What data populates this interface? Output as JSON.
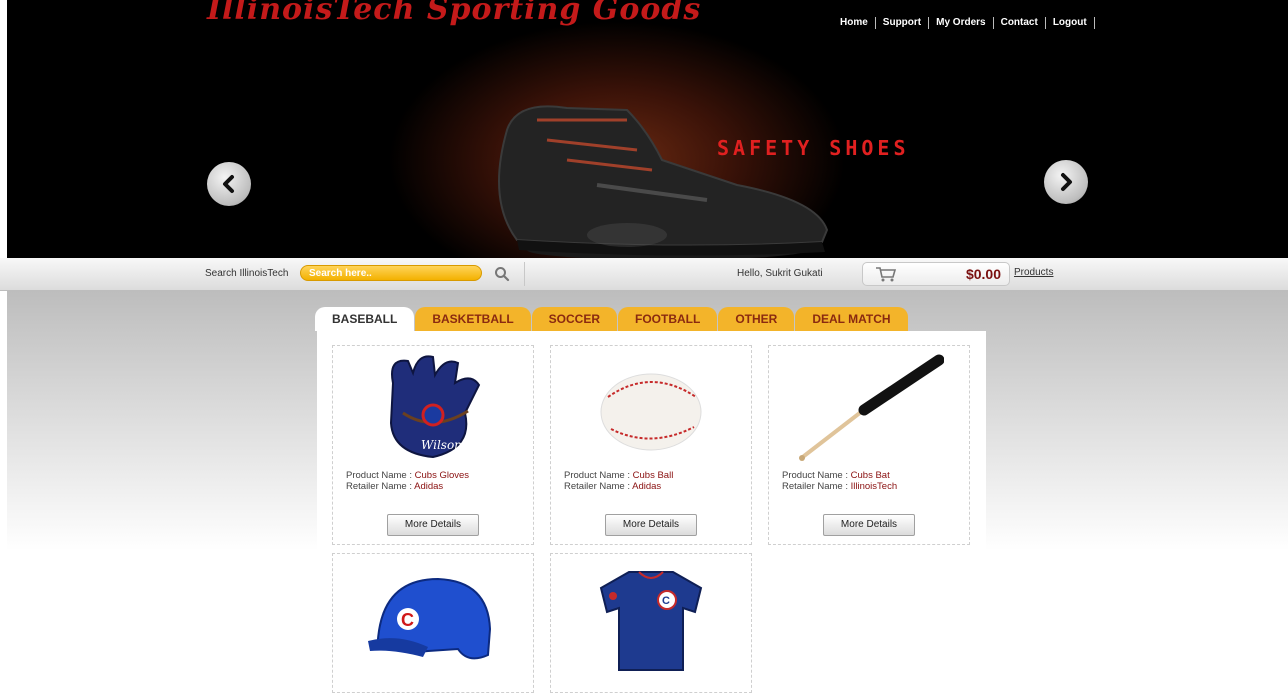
{
  "header": {
    "logo_text": "IllinoisTech Sporting Goods",
    "nav": [
      "Home",
      "Support",
      "My Orders",
      "Contact",
      "Logout"
    ]
  },
  "hero": {
    "slide_text": "SAFETY SHOES"
  },
  "searchbar": {
    "label": "Search IllinoisTech",
    "placeholder": "Search here..",
    "greeting": "Hello, Sukrit Gukati",
    "cart_total": "$0.00",
    "products_link": "Products"
  },
  "tabs": [
    "BASEBALL",
    "BASKETBALL",
    "SOCCER",
    "FOOTBALL",
    "OTHER",
    "DEAL MATCH"
  ],
  "active_tab": "BASEBALL",
  "products": [
    {
      "name": "Cubs Gloves",
      "retailer": "Adidas",
      "button": "More Details"
    },
    {
      "name": "Cubs Ball",
      "retailer": "Adidas",
      "button": "More Details"
    },
    {
      "name": "Cubs Bat",
      "retailer": "IllinoisTech",
      "button": "More Details"
    }
  ],
  "labels": {
    "product_name": "Product Name : ",
    "retailer_name": "Retailer Name : "
  },
  "colors": {
    "accent_orange": "#f3b42a",
    "brand_red": "#c41a1a",
    "price_red": "#7a1010"
  }
}
